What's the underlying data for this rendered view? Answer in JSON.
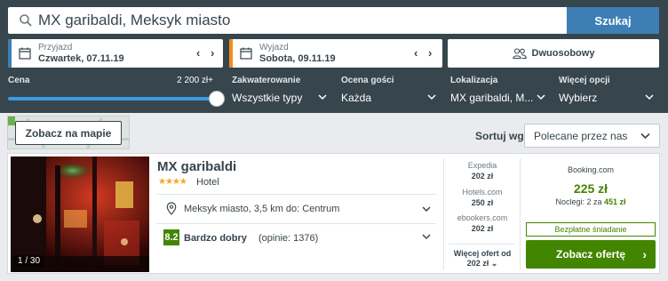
{
  "search": {
    "value": "MX garibaldi, Meksyk miasto",
    "button_label": "Szukaj"
  },
  "dates": {
    "checkin": {
      "label": "Przyjazd",
      "value": "Czwartek, 07.11.19"
    },
    "checkout": {
      "label": "Wyjazd",
      "value": "Sobota, 09.11.19"
    }
  },
  "room": {
    "label": "Dwuosobowy"
  },
  "filters": {
    "price": {
      "label": "Cena",
      "max": "2 200 zł+",
      "level_fraction": 1.0
    },
    "accommodation": {
      "label": "Zakwaterowanie",
      "value": "Wszystkie typy"
    },
    "rating": {
      "label": "Ocena gości",
      "value": "Każda"
    },
    "location": {
      "label": "Lokalizacja",
      "value": "MX garibaldi, M..."
    },
    "more": {
      "label": "Więcej opcji",
      "value": "Wybierz"
    }
  },
  "map_button": {
    "label": "Zobacz na mapie"
  },
  "sort": {
    "label": "Sortuj wg",
    "value": "Polecane przez nas"
  },
  "hotel": {
    "name": "MX garibaldi",
    "stars": "★★★★",
    "type": "Hotel",
    "photo_counter": "1 / 30",
    "location": "Meksyk miasto, 3,5 km do: Centrum",
    "rating_score": "8.2",
    "rating_word": "Bardzo dobry",
    "rating_count": "(opinie: 1376)"
  },
  "deals": [
    {
      "site": "Expedia",
      "price": "202 zł"
    },
    {
      "site": "Hotels.com",
      "price": "250 zł"
    },
    {
      "site": "ebookers.com",
      "price": "202 zł"
    }
  ],
  "more_deals": {
    "label": "Więcej ofert od",
    "price": "202 zł ⌄"
  },
  "best_deal": {
    "site": "Booking.com",
    "price": "225 zł",
    "nights_prefix": "Noclegi: 2 za ",
    "nights_total": "451 zł",
    "badge": "Bezpłatne śniadanie",
    "button_label": "Zobacz ofertę",
    "button_arrow": "›"
  },
  "colors": {
    "header_bg": "#37454d",
    "accent_blue": "#3d7fb5",
    "checkin_accent": "#3d7fb5",
    "checkout_accent": "#f58c1c",
    "deal_green": "#428500"
  }
}
